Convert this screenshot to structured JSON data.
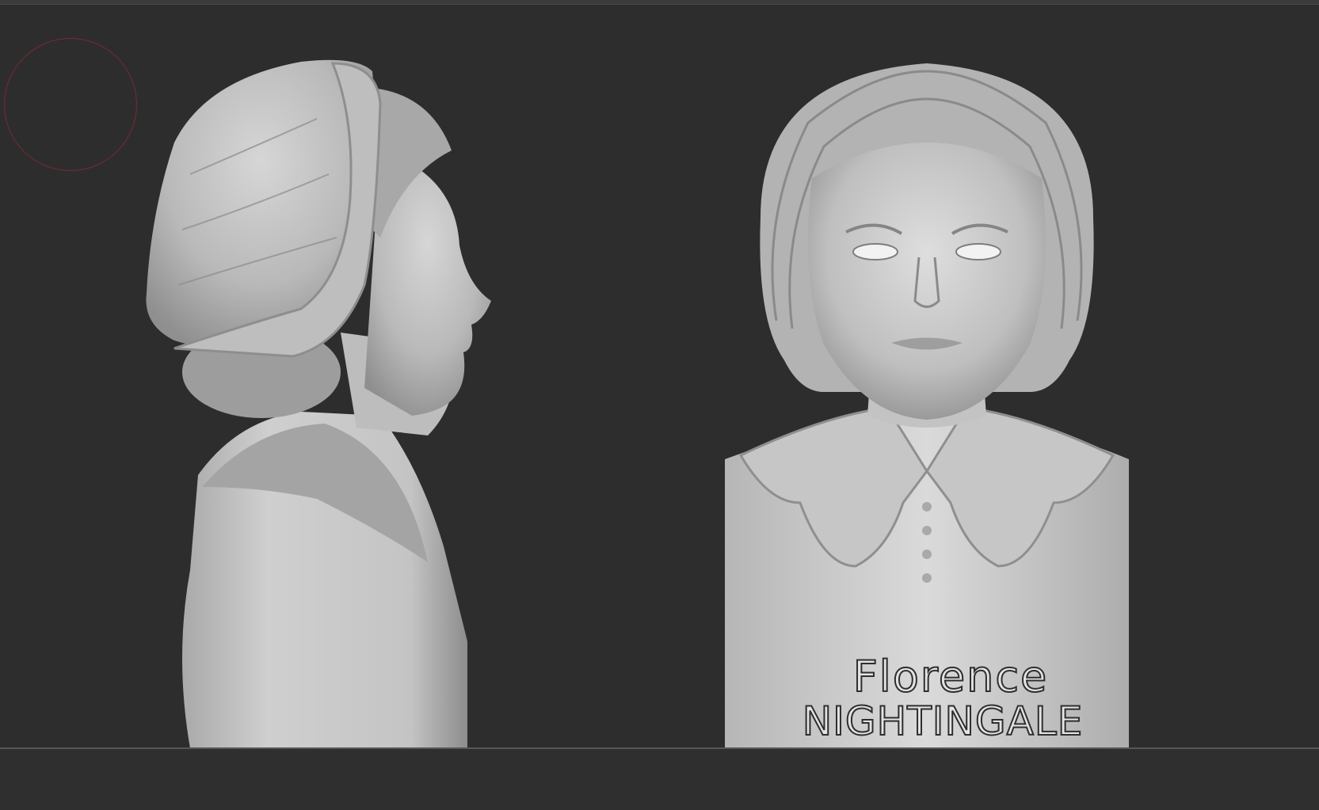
{
  "viewport": {
    "background": "#2d2d2e",
    "brush_color": "#7a2a2e"
  },
  "models": {
    "side_view": {
      "icon": "side-profile-bust"
    },
    "front_view": {
      "icon": "front-bust"
    }
  },
  "inscription": {
    "line1": "Florence",
    "line2": "NIGHTINGALE"
  }
}
